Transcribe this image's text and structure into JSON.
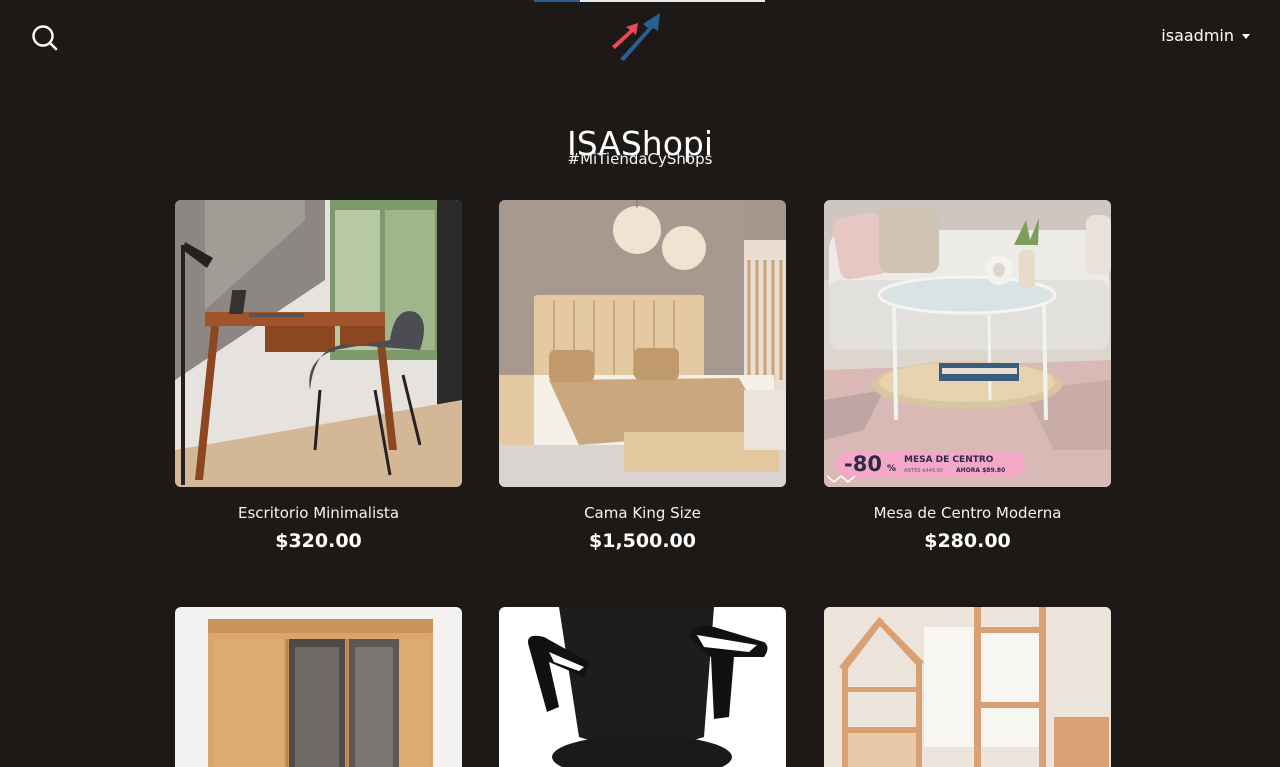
{
  "header": {
    "user_name": "isaadmin",
    "search_icon": "search-icon",
    "logo_icon": "rising-arrows-logo",
    "progress_fraction": 0.2
  },
  "store": {
    "title": "ISAShopi",
    "tagline": "#MiTiendaCyShops"
  },
  "products": [
    {
      "name": "Escritorio Minimalista",
      "price": "$320.00",
      "image": "desk-photo"
    },
    {
      "name": "Cama King Size",
      "price": "$1,500.00",
      "image": "bed-photo"
    },
    {
      "name": "Mesa de Centro Moderna",
      "price": "$280.00",
      "image": "coffee-table-photo",
      "promo": {
        "discount": "-80",
        "percent": "%",
        "label": "MESA DE CENTRO",
        "old_price": "ANTES $449.00",
        "new_price": "AHORA $89.80"
      }
    },
    {
      "name": "",
      "price": "",
      "image": "wardrobe-photo"
    },
    {
      "name": "",
      "price": "",
      "image": "office-chair-photo"
    },
    {
      "name": "",
      "price": "",
      "image": "bunk-bed-photo"
    }
  ],
  "colors": {
    "background": "#1c1916",
    "logo_red": "#f0485a",
    "logo_blue": "#2b5f94"
  }
}
